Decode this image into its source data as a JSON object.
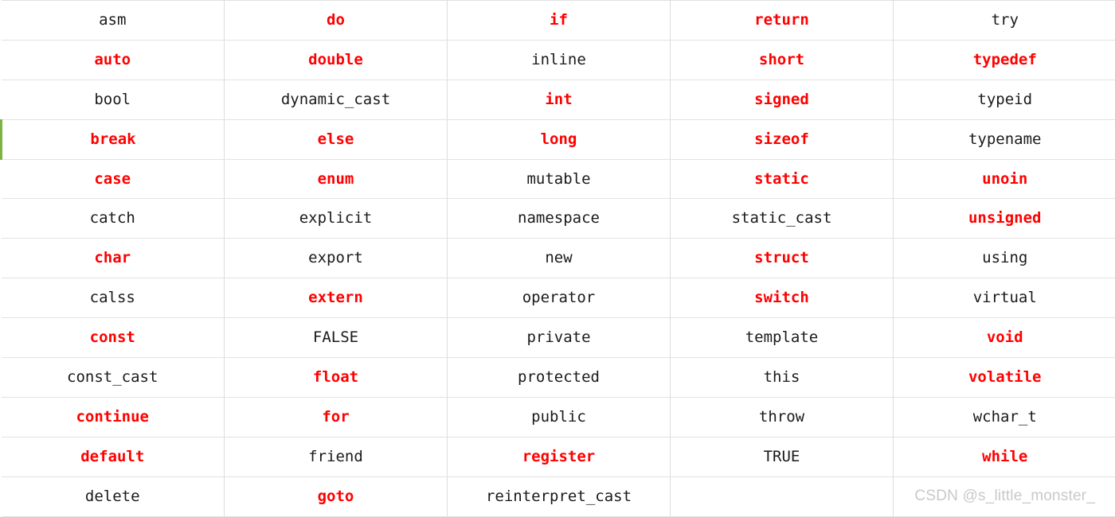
{
  "document": {
    "kind": "cpp-keyword-table",
    "columns": 5,
    "rows": 13,
    "colors": {
      "highlight": "#ff0000",
      "normal": "#1a1a1a",
      "grid_line": "#dcdcdc",
      "heavy_rule": "#c3c3c3",
      "row_accent": "#7cb342",
      "watermark": "#c9c9c9",
      "background": "#ffffff"
    }
  },
  "watermark": {
    "text": "CSDN @s_little_monster_"
  },
  "table": {
    "rows": [
      {
        "cells": [
          {
            "text": "asm",
            "style": "kw-black"
          },
          {
            "text": "do",
            "style": "kw-red"
          },
          {
            "text": "if",
            "style": "kw-red"
          },
          {
            "text": "return",
            "style": "kw-red"
          },
          {
            "text": "try",
            "style": "kw-black"
          }
        ]
      },
      {
        "cells": [
          {
            "text": "auto",
            "style": "kw-red"
          },
          {
            "text": "double",
            "style": "kw-red"
          },
          {
            "text": "inline",
            "style": "kw-black"
          },
          {
            "text": "short",
            "style": "kw-red"
          },
          {
            "text": "typedef",
            "style": "kw-red"
          }
        ]
      },
      {
        "cells": [
          {
            "text": "bool",
            "style": "kw-black"
          },
          {
            "text": "dynamic_cast",
            "style": "kw-black"
          },
          {
            "text": "int",
            "style": "kw-red"
          },
          {
            "text": "signed",
            "style": "kw-red"
          },
          {
            "text": "typeid",
            "style": "kw-black"
          }
        ]
      },
      {
        "cells": [
          {
            "text": "break",
            "style": "kw-red"
          },
          {
            "text": "else",
            "style": "kw-red"
          },
          {
            "text": "long",
            "style": "kw-red"
          },
          {
            "text": "sizeof",
            "style": "kw-red"
          },
          {
            "text": "typename",
            "style": "kw-black"
          }
        ]
      },
      {
        "cells": [
          {
            "text": "case",
            "style": "kw-red"
          },
          {
            "text": "enum",
            "style": "kw-red"
          },
          {
            "text": "mutable",
            "style": "kw-black"
          },
          {
            "text": "static",
            "style": "kw-red"
          },
          {
            "text": "unoin",
            "style": "kw-red"
          }
        ]
      },
      {
        "cells": [
          {
            "text": "catch",
            "style": "kw-black"
          },
          {
            "text": "explicit",
            "style": "kw-black"
          },
          {
            "text": "namespace",
            "style": "kw-black"
          },
          {
            "text": "static_cast",
            "style": "kw-black"
          },
          {
            "text": "unsigned",
            "style": "kw-red"
          }
        ]
      },
      {
        "cells": [
          {
            "text": "char",
            "style": "kw-red"
          },
          {
            "text": "export",
            "style": "kw-black"
          },
          {
            "text": "new",
            "style": "kw-black"
          },
          {
            "text": "struct",
            "style": "kw-red"
          },
          {
            "text": "using",
            "style": "kw-black"
          }
        ]
      },
      {
        "cells": [
          {
            "text": "calss",
            "style": "kw-black"
          },
          {
            "text": "extern",
            "style": "kw-red"
          },
          {
            "text": "operator",
            "style": "kw-black"
          },
          {
            "text": "switch",
            "style": "kw-red"
          },
          {
            "text": "virtual",
            "style": "kw-black"
          }
        ]
      },
      {
        "cells": [
          {
            "text": "const",
            "style": "kw-red"
          },
          {
            "text": "FALSE",
            "style": "kw-black"
          },
          {
            "text": "private",
            "style": "kw-black"
          },
          {
            "text": "template",
            "style": "kw-black"
          },
          {
            "text": "void",
            "style": "kw-red"
          }
        ]
      },
      {
        "cells": [
          {
            "text": "const_cast",
            "style": "kw-black"
          },
          {
            "text": "float",
            "style": "kw-red"
          },
          {
            "text": "protected",
            "style": "kw-black"
          },
          {
            "text": "this",
            "style": "kw-black"
          },
          {
            "text": "volatile",
            "style": "kw-red"
          }
        ]
      },
      {
        "cells": [
          {
            "text": "continue",
            "style": "kw-red"
          },
          {
            "text": "for",
            "style": "kw-red"
          },
          {
            "text": "public",
            "style": "kw-black"
          },
          {
            "text": "throw",
            "style": "kw-black"
          },
          {
            "text": "wchar_t",
            "style": "kw-black"
          }
        ]
      },
      {
        "cells": [
          {
            "text": "default",
            "style": "kw-red"
          },
          {
            "text": "friend",
            "style": "kw-black"
          },
          {
            "text": "register",
            "style": "kw-red"
          },
          {
            "text": "TRUE",
            "style": "kw-black"
          },
          {
            "text": "while",
            "style": "kw-red"
          }
        ]
      },
      {
        "cells": [
          {
            "text": "delete",
            "style": "kw-black"
          },
          {
            "text": "goto",
            "style": "kw-red"
          },
          {
            "text": "reinterpret_cast",
            "style": "kw-black"
          },
          {
            "text": "",
            "style": "kw-empty"
          },
          {
            "text": "CSDN @s_little_monster_",
            "style": "watermark"
          }
        ]
      }
    ]
  }
}
